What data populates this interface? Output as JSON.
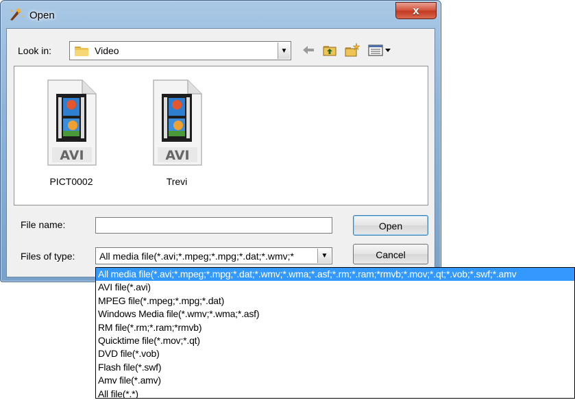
{
  "window": {
    "title": "Open",
    "close_label": "x"
  },
  "lookin": {
    "label": "Look in:",
    "value": "Video"
  },
  "files": [
    {
      "name": "PICT0002",
      "type_label": "AVI"
    },
    {
      "name": "Trevi",
      "type_label": "AVI"
    }
  ],
  "filename": {
    "label": "File name:",
    "value": ""
  },
  "filetype": {
    "label": "Files of type:",
    "value": "All media file(*.avi;*.mpeg;*.mpg;*.dat;*.wmv;*"
  },
  "buttons": {
    "open": "Open",
    "cancel": "Cancel"
  },
  "dropdown": {
    "selected_index": 0,
    "options": [
      "All media file(*.avi;*.mpeg;*.mpg;*.dat;*.wmv;*.wma;*.asf;*.rm;*.ram;*rmvb;*.mov;*.qt;*.vob;*.swf;*.amv",
      "AVI file(*.avi)",
      "MPEG file(*.mpeg;*.mpg;*.dat)",
      "Windows Media file(*.wmv;*.wma;*.asf)",
      "RM file(*.rm;*.ram;*rmvb)",
      "Quicktime file(*.mov;*.qt)",
      "DVD file(*.vob)",
      "Flash file(*.swf)",
      "Amv file(*.amv)",
      "All file(*.*)"
    ]
  },
  "colors": {
    "selection": "#3399ff",
    "close_button": "#c33b22",
    "title_bar": "#8fb3d8"
  }
}
